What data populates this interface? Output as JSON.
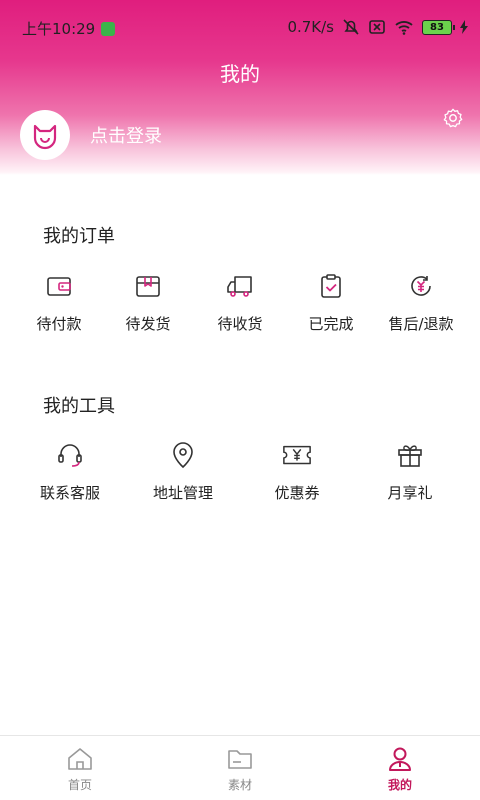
{
  "status": {
    "time": "上午10:29",
    "network_speed": "0.7K/s",
    "battery_level": "83"
  },
  "header": {
    "title": "我的",
    "login_label": "点击登录"
  },
  "orders": {
    "title": "我的订单",
    "items": [
      {
        "label": "待付款",
        "icon": "wallet-icon"
      },
      {
        "label": "待发货",
        "icon": "package-icon"
      },
      {
        "label": "待收货",
        "icon": "truck-icon"
      },
      {
        "label": "已完成",
        "icon": "clipboard-check-icon"
      },
      {
        "label": "售后/退款",
        "icon": "refund-icon"
      }
    ]
  },
  "tools": {
    "title": "我的工具",
    "items": [
      {
        "label": "联系客服",
        "icon": "headset-icon"
      },
      {
        "label": "地址管理",
        "icon": "location-pin-icon"
      },
      {
        "label": "优惠券",
        "icon": "coupon-icon"
      },
      {
        "label": "月享礼",
        "icon": "gift-icon"
      }
    ]
  },
  "tabbar": {
    "tabs": [
      {
        "label": "首页",
        "icon": "home-icon"
      },
      {
        "label": "素材",
        "icon": "folder-icon"
      },
      {
        "label": "我的",
        "icon": "user-icon"
      }
    ],
    "active_tab": "我的"
  },
  "colors": {
    "brand": "#e01e7e",
    "active_tab": "#c2185b"
  }
}
